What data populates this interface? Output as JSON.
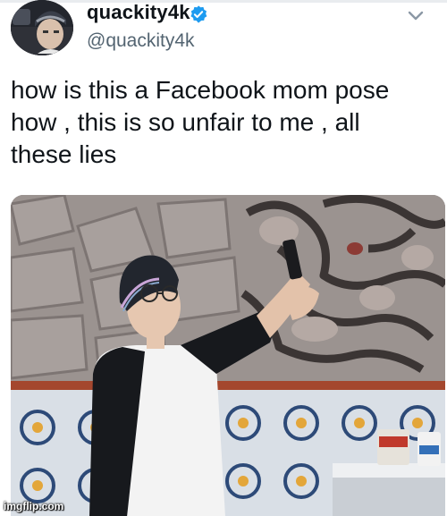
{
  "tweet": {
    "display_name": "quackity4k",
    "handle": "@quackity4k",
    "text": "how is this a Facebook mom pose\nhow , this is so unfair to me , all\nthese lies",
    "verified": true
  },
  "media": {
    "description_icon": "photo"
  },
  "watermark": "imgflip.com",
  "colors": {
    "verified_blue": "#1d9bf0",
    "text": "#0f1419",
    "secondary": "#536471"
  }
}
